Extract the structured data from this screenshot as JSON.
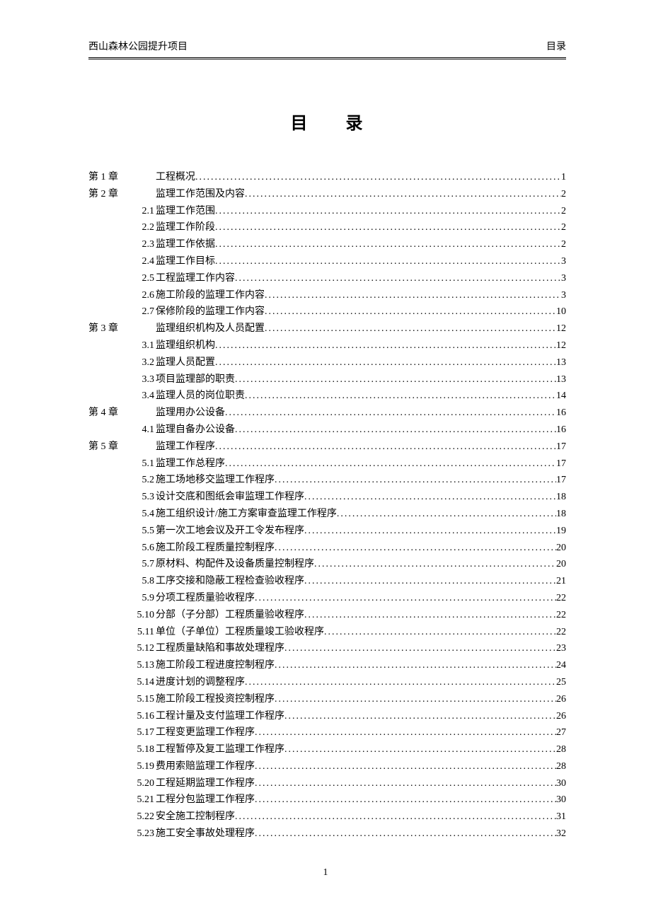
{
  "header": {
    "left": "西山森林公园提升项目",
    "right": "目录"
  },
  "title": "目　　录",
  "footer_page": "1",
  "toc": [
    {
      "level": "chapter",
      "label": "第 1 章",
      "title": "工程概况",
      "page": "1"
    },
    {
      "level": "chapter",
      "label": "第 2 章",
      "title": "监理工作范围及内容",
      "page": "2"
    },
    {
      "level": "section",
      "label": "2.1",
      "title": "监理工作范围",
      "page": "2"
    },
    {
      "level": "section",
      "label": "2.2",
      "title": "监理工作阶段",
      "page": "2"
    },
    {
      "level": "section",
      "label": "2.3",
      "title": "监理工作依据",
      "page": "2"
    },
    {
      "level": "section",
      "label": "2.4",
      "title": "监理工作目标",
      "page": "3"
    },
    {
      "level": "section",
      "label": "2.5",
      "title": "工程监理工作内容",
      "page": "3"
    },
    {
      "level": "section",
      "label": "2.6",
      "title": "施工阶段的监理工作内容",
      "page": "3"
    },
    {
      "level": "section",
      "label": "2.7",
      "title": "保修阶段的监理工作内容",
      "page": "10"
    },
    {
      "level": "chapter",
      "label": "第 3 章",
      "title": "监理组织机构及人员配置",
      "page": "12"
    },
    {
      "level": "section",
      "label": "3.1",
      "title": "监理组织机构",
      "page": "12"
    },
    {
      "level": "section",
      "label": "3.2",
      "title": "监理人员配置",
      "page": "13"
    },
    {
      "level": "section",
      "label": "3.3",
      "title": "项目监理部的职责",
      "page": "13"
    },
    {
      "level": "section",
      "label": "3.4",
      "title": "监理人员的岗位职责",
      "page": "14"
    },
    {
      "level": "chapter",
      "label": "第 4 章",
      "title": "监理用办公设备",
      "page": "16"
    },
    {
      "level": "section",
      "label": "4.1",
      "title": "监理自备办公设备",
      "page": "16"
    },
    {
      "level": "chapter",
      "label": "第 5 章",
      "title": "监理工作程序",
      "page": "17"
    },
    {
      "level": "section",
      "label": "5.1",
      "title": "监理工作总程序",
      "page": "17"
    },
    {
      "level": "section",
      "label": "5.2",
      "title": "施工场地移交监理工作程序",
      "page": "17"
    },
    {
      "level": "section",
      "label": "5.3",
      "title": "设计交底和图纸会审监理工作程序",
      "page": "18"
    },
    {
      "level": "section",
      "label": "5.4",
      "title": "施工组织设计/施工方案审查监理工作程序",
      "page": "18"
    },
    {
      "level": "section",
      "label": "5.5",
      "title": "第一次工地会议及开工令发布程序",
      "page": "19"
    },
    {
      "level": "section",
      "label": "5.6",
      "title": "施工阶段工程质量控制程序",
      "page": "20"
    },
    {
      "level": "section",
      "label": "5.7",
      "title": "原材料、构配件及设备质量控制程序",
      "page": "20"
    },
    {
      "level": "section",
      "label": "5.8",
      "title": "工序交接和隐蔽工程检查验收程序",
      "page": "21"
    },
    {
      "level": "section",
      "label": "5.9",
      "title": "分项工程质量验收程序",
      "page": "22"
    },
    {
      "level": "section",
      "label": "5.10",
      "title": "分部（子分部）工程质量验收程序",
      "page": "22"
    },
    {
      "level": "section",
      "label": "5.11",
      "title": "单位（子单位）工程质量竣工验收程序",
      "page": "22"
    },
    {
      "level": "section",
      "label": "5.12",
      "title": "工程质量缺陷和事故处理程序",
      "page": "23"
    },
    {
      "level": "section",
      "label": "5.13",
      "title": "施工阶段工程进度控制程序",
      "page": "24"
    },
    {
      "level": "section",
      "label": "5.14",
      "title": "进度计划的调整程序",
      "page": "25"
    },
    {
      "level": "section",
      "label": "5.15",
      "title": "施工阶段工程投资控制程序",
      "page": "26"
    },
    {
      "level": "section",
      "label": "5.16",
      "title": "工程计量及支付监理工作程序",
      "page": "26"
    },
    {
      "level": "section",
      "label": "5.17",
      "title": "工程变更监理工作程序",
      "page": "27"
    },
    {
      "level": "section",
      "label": "5.18",
      "title": "工程暂停及复工监理工作程序",
      "page": "28"
    },
    {
      "level": "section",
      "label": "5.19",
      "title": "费用索赔监理工作程序",
      "page": "28"
    },
    {
      "level": "section",
      "label": "5.20",
      "title": "工程延期监理工作程序",
      "page": "30"
    },
    {
      "level": "section",
      "label": "5.21",
      "title": "工程分包监理工作程序",
      "page": "30"
    },
    {
      "level": "section",
      "label": "5.22",
      "title": "安全施工控制程序",
      "page": "31"
    },
    {
      "level": "section",
      "label": "5.23",
      "title": "施工安全事故处理程序",
      "page": "32"
    }
  ]
}
